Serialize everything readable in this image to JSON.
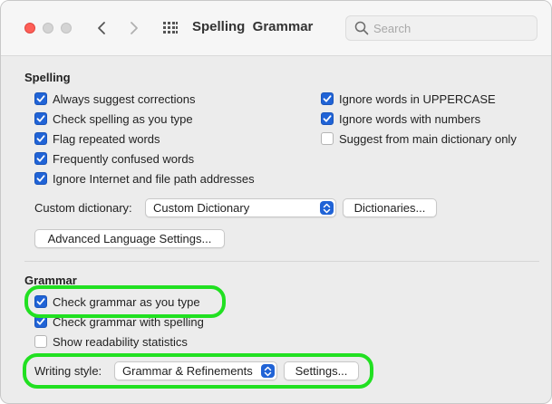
{
  "window": {
    "title": "Spelling  Grammar",
    "search_placeholder": "Search"
  },
  "spelling": {
    "heading": "Spelling",
    "left_options": [
      {
        "label": "Always suggest corrections",
        "checked": true
      },
      {
        "label": "Check spelling as you type",
        "checked": true
      },
      {
        "label": "Flag repeated words",
        "checked": true
      },
      {
        "label": "Frequently confused words",
        "checked": true
      },
      {
        "label": "Ignore Internet and file path addresses",
        "checked": true
      }
    ],
    "right_options": [
      {
        "label": "Ignore words in UPPERCASE",
        "checked": true
      },
      {
        "label": "Ignore words with numbers",
        "checked": true
      },
      {
        "label": "Suggest from main dictionary only",
        "checked": false
      }
    ],
    "custom_dictionary_label": "Custom dictionary:",
    "custom_dictionary_value": "Custom Dictionary",
    "dictionaries_button": "Dictionaries...",
    "advanced_button": "Advanced Language Settings..."
  },
  "grammar": {
    "heading": "Grammar",
    "options": [
      {
        "label": "Check grammar as you type",
        "checked": true
      },
      {
        "label": "Check grammar with spelling",
        "checked": true
      },
      {
        "label": "Show readability statistics",
        "checked": false
      }
    ],
    "writing_style_label": "Writing style:",
    "writing_style_value": "Grammar & Refinements",
    "settings_button": "Settings..."
  },
  "colors": {
    "accent": "#2063d6",
    "highlight": "#21e021"
  }
}
